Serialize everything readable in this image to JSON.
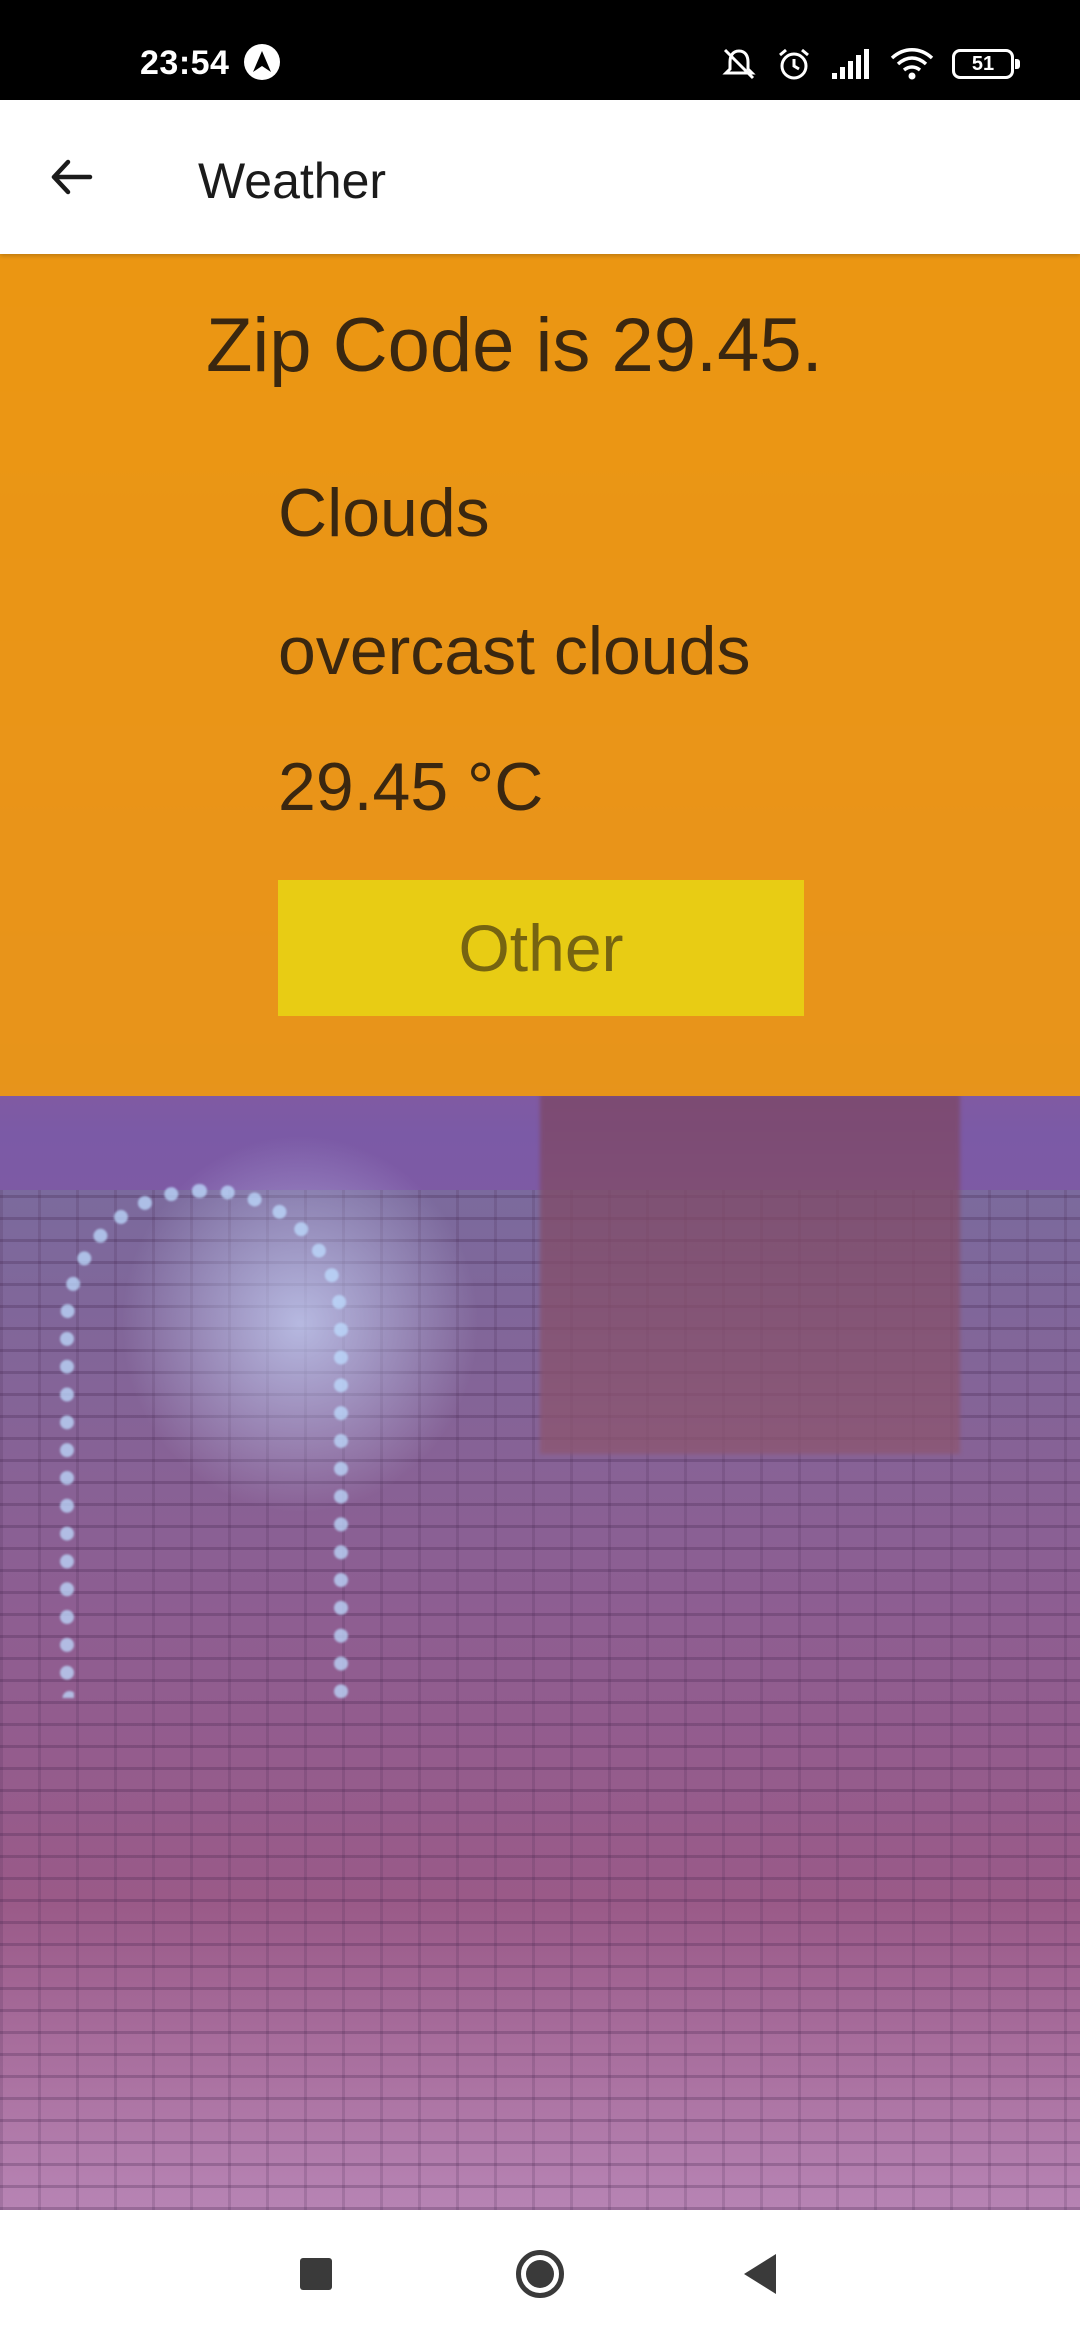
{
  "status_bar": {
    "time": "23:54",
    "app_icon": "nav-arrow-icon",
    "icons": [
      "mute-icon",
      "alarm-icon",
      "signal-icon",
      "wifi-icon"
    ],
    "battery": "51"
  },
  "app_bar": {
    "back_icon": "arrow-left-icon",
    "title": "Weather"
  },
  "weather": {
    "zip_line": "Zip Code is 29.45.",
    "main": "Clouds",
    "description": "overcast clouds",
    "temperature": "29.45 °C",
    "other_button": "Other"
  },
  "nav_bar": {
    "recent_icon": "square-icon",
    "home_icon": "circle-icon",
    "back_icon": "triangle-back-icon"
  },
  "colors": {
    "panel": "#EF9910",
    "button": "#E8CC14",
    "text": "#3A2710"
  }
}
